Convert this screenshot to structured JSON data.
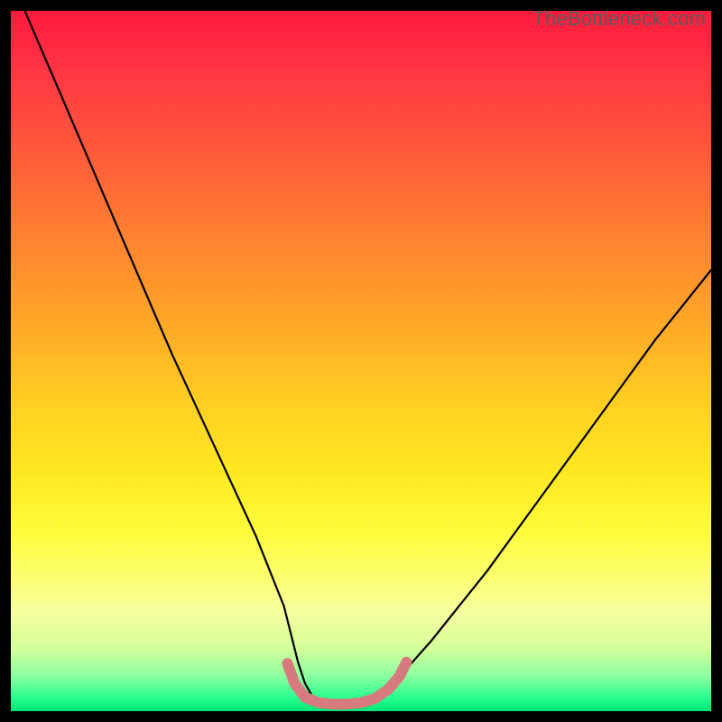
{
  "watermark": "TheBottleneck.com",
  "chart_data": {
    "type": "line",
    "title": "",
    "xlabel": "",
    "ylabel": "",
    "xlim": [
      0,
      100
    ],
    "ylim": [
      0,
      100
    ],
    "background": {
      "type": "vertical-gradient",
      "meaning": "bottleneck severity (top=high/red, bottom=low/green)",
      "stops": [
        {
          "pct": 0,
          "color": "#ff1a3c"
        },
        {
          "pct": 20,
          "color": "#ff5a3a"
        },
        {
          "pct": 44,
          "color": "#ffa628"
        },
        {
          "pct": 66,
          "color": "#ffe822"
        },
        {
          "pct": 86,
          "color": "#f6ffa0"
        },
        {
          "pct": 100,
          "color": "#00e676"
        }
      ]
    },
    "series": [
      {
        "name": "bottleneck-curve",
        "color": "#000000",
        "x": [
          2,
          5,
          8,
          11,
          14,
          17,
          20,
          23,
          26,
          29,
          32,
          35,
          37,
          39,
          40,
          41,
          42,
          43,
          44,
          45,
          46,
          48,
          50,
          53,
          56,
          60,
          64,
          68,
          72,
          76,
          80,
          84,
          88,
          92,
          96,
          100
        ],
        "values": [
          100,
          93,
          86,
          79,
          72,
          65,
          58,
          51,
          44.5,
          38,
          31.5,
          25,
          20,
          15,
          11,
          7,
          4,
          2.2,
          1.2,
          1,
          1,
          1,
          1.2,
          2.5,
          5.5,
          10,
          15,
          20,
          25.5,
          31,
          36.5,
          42,
          47.5,
          53,
          58,
          63
        ]
      },
      {
        "name": "optimal-zone-marker",
        "color": "#d67a7d",
        "thick": true,
        "x": [
          39.5,
          40.5,
          42,
          44,
          46,
          48,
          50,
          52,
          54,
          55.5,
          56.5
        ],
        "values": [
          6.8,
          4.0,
          2.0,
          1.2,
          1.0,
          1.0,
          1.2,
          1.8,
          3.2,
          5.0,
          7.0
        ]
      }
    ],
    "optimal_range_x": [
      41,
      55
    ]
  }
}
